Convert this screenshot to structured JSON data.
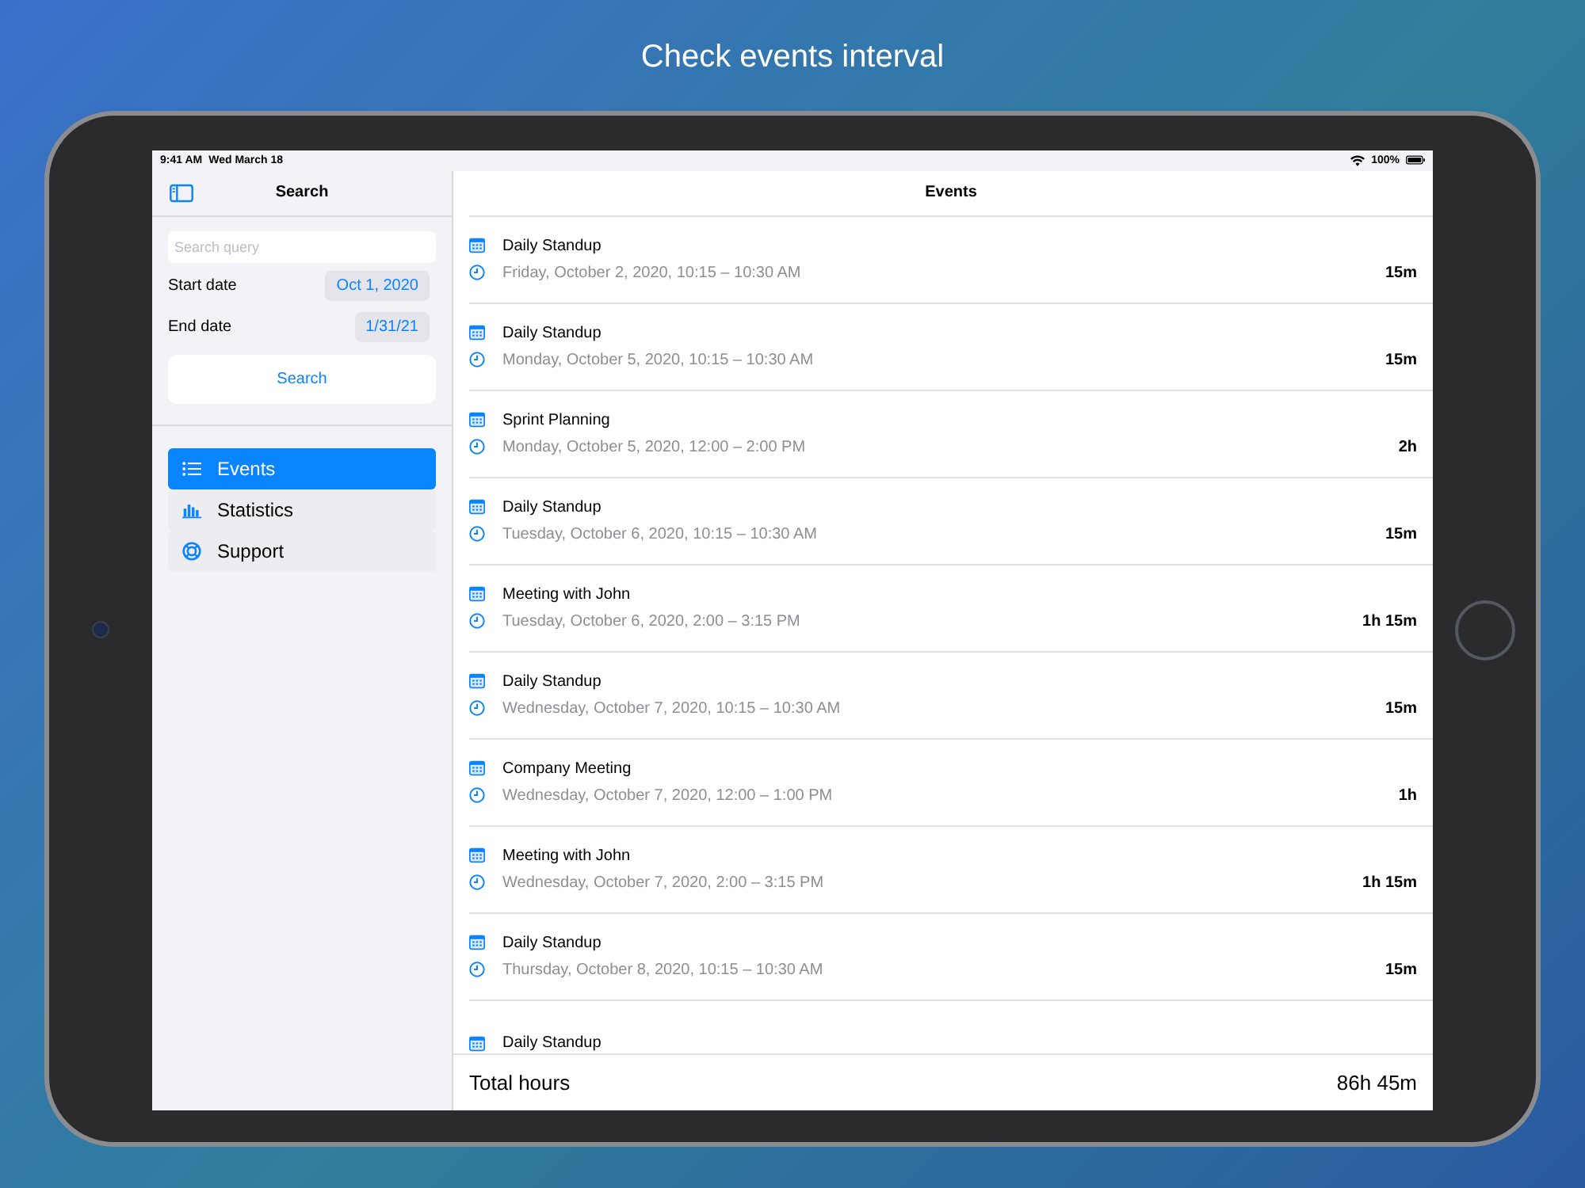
{
  "headline": "Check events interval",
  "status_bar": {
    "time": "9:41 AM",
    "date": "Wed March 18",
    "battery": "100%"
  },
  "sidebar": {
    "title": "Search",
    "search": {
      "placeholder": "Search query"
    },
    "start_date": {
      "label": "Start date",
      "value": "Oct 1, 2020"
    },
    "end_date": {
      "label": "End date",
      "value": "1/31/21"
    },
    "search_button": "Search",
    "items": [
      {
        "label": "Events",
        "kind": "list",
        "selected": true
      },
      {
        "label": "Statistics",
        "kind": "chart",
        "selected": false
      },
      {
        "label": "Support",
        "kind": "lifebuoy",
        "selected": false
      }
    ]
  },
  "main": {
    "title": "Events",
    "events": [
      {
        "title": "Daily Standup",
        "time": "Friday, October 2, 2020, 10:15 – 10:30 AM",
        "duration": "15m"
      },
      {
        "title": "Daily Standup",
        "time": "Monday, October 5, 2020, 10:15 – 10:30 AM",
        "duration": "15m"
      },
      {
        "title": "Sprint Planning",
        "time": "Monday, October 5, 2020, 12:00 – 2:00 PM",
        "duration": "2h"
      },
      {
        "title": "Daily Standup",
        "time": "Tuesday, October 6, 2020, 10:15 – 10:30 AM",
        "duration": "15m"
      },
      {
        "title": "Meeting with John",
        "time": "Tuesday, October 6, 2020, 2:00 – 3:15 PM",
        "duration": "1h 15m"
      },
      {
        "title": "Daily Standup",
        "time": "Wednesday, October 7, 2020, 10:15 – 10:30 AM",
        "duration": "15m"
      },
      {
        "title": "Company Meeting",
        "time": "Wednesday, October 7, 2020, 12:00 – 1:00 PM",
        "duration": "1h"
      },
      {
        "title": "Meeting with John",
        "time": "Wednesday, October 7, 2020, 2:00 – 3:15 PM",
        "duration": "1h 15m"
      },
      {
        "title": "Daily Standup",
        "time": "Thursday, October 8, 2020, 10:15 – 10:30 AM",
        "duration": "15m"
      },
      {
        "title": "Daily Standup"
      }
    ],
    "total": {
      "label": "Total hours",
      "value": "86h 45m"
    }
  }
}
